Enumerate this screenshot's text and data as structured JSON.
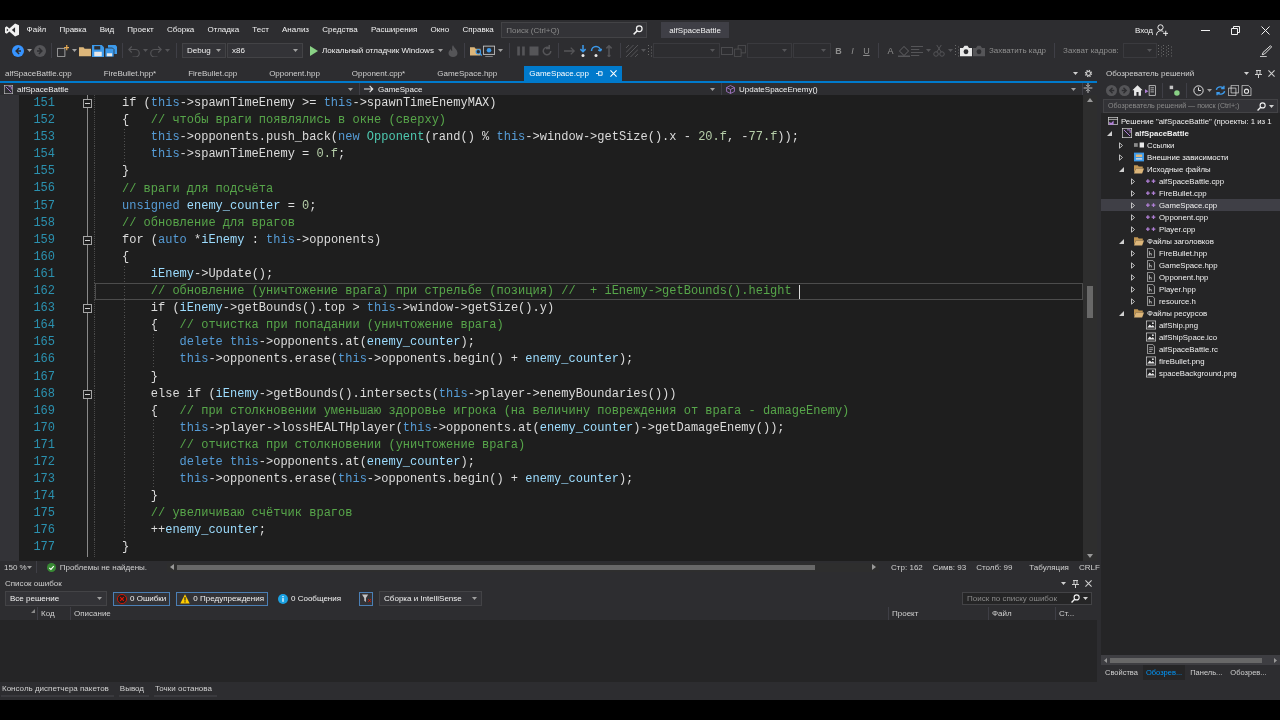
{
  "title_bar": {
    "menu": [
      "Файл",
      "Правка",
      "Вид",
      "Проект",
      "Сборка",
      "Отладка",
      "Тест",
      "Анализ",
      "Средства",
      "Расширения",
      "Окно",
      "Справка"
    ],
    "search": {
      "placeholder": "Поиск (Ctrl+Q)"
    },
    "solution_name": "alfSpaceBattle",
    "sign_in": "Вход"
  },
  "toolbar": {
    "items": [
      {
        "kind": "icon",
        "disabled": false,
        "dropdown": true
      },
      {
        "kind": "icon",
        "disabled": true,
        "dropdown": false
      },
      {
        "kind": "separator"
      },
      {
        "kind": "icon",
        "disabled": false,
        "dropdown": true
      },
      {
        "kind": "icon",
        "disabled": false,
        "dropdown": false
      },
      {
        "kind": "icon",
        "disabled": false,
        "dropdown": false
      },
      {
        "kind": "icon",
        "disabled": false,
        "dropdown": false
      },
      {
        "kind": "separator"
      },
      {
        "kind": "icon",
        "disabled": true,
        "dropdown": true
      },
      {
        "kind": "icon",
        "disabled": true,
        "dropdown": true
      },
      {
        "kind": "separator"
      },
      {
        "kind": "combo",
        "value": "Debug",
        "disabled": false
      },
      {
        "kind": "combo",
        "value": "x86",
        "disabled": false
      },
      {
        "kind": "run",
        "label": "Локальный отладчик Windows"
      },
      {
        "kind": "icon",
        "disabled": true,
        "dropdown": false
      },
      {
        "kind": "separator"
      },
      {
        "kind": "icon",
        "disabled": false,
        "dropdown": false
      },
      {
        "kind": "icon",
        "disabled": false,
        "dropdown": true
      },
      {
        "kind": "separator"
      },
      {
        "kind": "icon",
        "disabled": true,
        "dropdown": false
      },
      {
        "kind": "icon",
        "disabled": true,
        "dropdown": false
      },
      {
        "kind": "icon",
        "disabled": true,
        "dropdown": false
      },
      {
        "kind": "separator"
      },
      {
        "kind": "icon",
        "disabled": true,
        "dropdown": false
      },
      {
        "kind": "icon",
        "disabled": false,
        "dropdown": false
      },
      {
        "kind": "icon",
        "disabled": false,
        "dropdown": false
      },
      {
        "kind": "icon",
        "disabled": true,
        "dropdown": false
      },
      {
        "kind": "separator"
      },
      {
        "kind": "icon",
        "disabled": true,
        "dropdown": true
      },
      {
        "kind": "grip"
      },
      {
        "kind": "combo",
        "disabled": true
      },
      {
        "kind": "icon",
        "disabled": true,
        "dropdown": false
      },
      {
        "kind": "icon",
        "disabled": true,
        "dropdown": false
      },
      {
        "kind": "combo",
        "disabled": true
      },
      {
        "kind": "combo",
        "disabled": true
      },
      {
        "kind": "glyph",
        "text": "B",
        "disabled": true
      },
      {
        "kind": "glyph",
        "text": "I",
        "disabled": true
      },
      {
        "kind": "glyph",
        "text": "U",
        "disabled": true
      },
      {
        "kind": "separator"
      },
      {
        "kind": "glyph",
        "text": "A",
        "disabled": true
      },
      {
        "kind": "icon",
        "disabled": true,
        "dropdown": false
      },
      {
        "kind": "icon",
        "disabled": true,
        "dropdown": true
      },
      {
        "kind": "icon",
        "disabled": true,
        "dropdown": true
      },
      {
        "kind": "grip"
      },
      {
        "kind": "icon",
        "disabled": false,
        "dropdown": false
      },
      {
        "kind": "icon",
        "disabled": true,
        "dropdown": false
      },
      {
        "kind": "label",
        "text": "Захватить кадр",
        "disabled": true
      },
      {
        "kind": "separator"
      },
      {
        "kind": "label",
        "text": "Захват кадров:",
        "disabled": true
      },
      {
        "kind": "combo",
        "disabled": true
      },
      {
        "kind": "grip"
      },
      {
        "kind": "grip"
      },
      {
        "kind": "grip"
      },
      {
        "kind": "icon",
        "disabled": false,
        "dropdown": false
      }
    ]
  },
  "document_tabs": [
    {
      "label": "alfSpaceBattle.cpp",
      "selected": false
    },
    {
      "label": "FireBullet.hpp*",
      "selected": false
    },
    {
      "label": "FireBullet.cpp",
      "selected": false
    },
    {
      "label": "Opponent.hpp",
      "selected": false
    },
    {
      "label": "Opponent.cpp*",
      "selected": false
    },
    {
      "label": "GameSpace.hpp",
      "selected": false
    },
    {
      "label": "GameSpace.cpp",
      "selected": true
    }
  ],
  "navigation_bar": {
    "project": "alfSpaceBattle",
    "scope": "GameSpace",
    "member": "UpdateSpaceEnemy()"
  },
  "editor": {
    "lines": [
      {
        "number": "151",
        "current": false,
        "expanded": true,
        "tokens": [
          {
            "kind": "plain",
            "text": "if ("
          },
          {
            "kind": "keyword",
            "text": "this"
          },
          {
            "kind": "plain",
            "text": "->spawnTimeEnemy >= "
          },
          {
            "kind": "keyword",
            "text": "this"
          },
          {
            "kind": "plain",
            "text": "->spawnTimeEnemyMAX)"
          }
        ]
      },
      {
        "number": "152",
        "current": false,
        "tokens": [
          {
            "kind": "plain",
            "text": "{   "
          },
          {
            "kind": "comment",
            "text": "// чтобы враги появлялись в окне (сверху)"
          }
        ],
        "children": [
          {
            "number": "153",
            "current": false,
            "tokens": [
              {
                "kind": "keyword",
                "text": "this"
              },
              {
                "kind": "plain",
                "text": "->opponents.push_back("
              },
              {
                "kind": "keyword",
                "text": "new "
              },
              {
                "kind": "type",
                "text": "Opponent"
              },
              {
                "kind": "plain",
                "text": "(rand() % "
              },
              {
                "kind": "keyword",
                "text": "this"
              },
              {
                "kind": "plain",
                "text": "->window->getSize().x - "
              },
              {
                "kind": "number",
                "text": "20.f"
              },
              {
                "kind": "plain",
                "text": ", -"
              },
              {
                "kind": "number",
                "text": "77.f"
              },
              {
                "kind": "plain",
                "text": "));"
              }
            ]
          },
          {
            "number": "154",
            "current": false,
            "tokens": [
              {
                "kind": "keyword",
                "text": "this"
              },
              {
                "kind": "plain",
                "text": "->spawnTimeEnemy = "
              },
              {
                "kind": "number",
                "text": "0.f"
              },
              {
                "kind": "plain",
                "text": ";"
              }
            ]
          }
        ]
      },
      {
        "number": "155",
        "current": false,
        "tokens": [
          {
            "kind": "plain",
            "text": "}"
          }
        ]
      },
      {
        "number": "156",
        "current": false,
        "tokens": [
          {
            "kind": "comment",
            "text": "// враги для подсчёта"
          }
        ]
      },
      {
        "number": "157",
        "current": false,
        "tokens": [
          {
            "kind": "keyword",
            "text": "unsigned "
          },
          {
            "kind": "local",
            "text": "enemy_counter"
          },
          {
            "kind": "plain",
            "text": " = "
          },
          {
            "kind": "number",
            "text": "0"
          },
          {
            "kind": "plain",
            "text": ";"
          }
        ]
      },
      {
        "number": "158",
        "current": false,
        "tokens": [
          {
            "kind": "comment",
            "text": "// обновление для врагов"
          }
        ]
      },
      {
        "number": "159",
        "current": false,
        "expanded": true,
        "tokens": [
          {
            "kind": "plain",
            "text": "for ("
          },
          {
            "kind": "keyword",
            "text": "auto"
          },
          {
            "kind": "plain",
            "text": " *"
          },
          {
            "kind": "local",
            "text": "iEnemy"
          },
          {
            "kind": "plain",
            "text": " : "
          },
          {
            "kind": "keyword",
            "text": "this"
          },
          {
            "kind": "plain",
            "text": "->opponents)"
          }
        ]
      },
      {
        "number": "160",
        "current": false,
        "tokens": [
          {
            "kind": "plain",
            "text": "{"
          }
        ],
        "children": [
          {
            "number": "161",
            "current": false,
            "tokens": [
              {
                "kind": "local",
                "text": "iEnemy"
              },
              {
                "kind": "plain",
                "text": "->Update();"
              }
            ]
          },
          {
            "number": "162",
            "current": true,
            "tokens": [
              {
                "kind": "comment",
                "text": "// обновление (уничтожение врага) при стрельбе (позиция) //  + iEnemy->getBounds().height"
              }
            ]
          },
          {
            "number": "163",
            "current": false,
            "expanded": true,
            "tokens": [
              {
                "kind": "plain",
                "text": "if ("
              },
              {
                "kind": "local",
                "text": "iEnemy"
              },
              {
                "kind": "plain",
                "text": "->getBounds().top > "
              },
              {
                "kind": "keyword",
                "text": "this"
              },
              {
                "kind": "plain",
                "text": "->window->getSize().y)"
              }
            ]
          },
          {
            "number": "164",
            "current": false,
            "tokens": [
              {
                "kind": "plain",
                "text": "{   "
              },
              {
                "kind": "comment",
                "text": "// отчистка при попадании (уничтожение врага)"
              }
            ],
            "children": [
              {
                "number": "165",
                "current": false,
                "tokens": [
                  {
                    "kind": "keyword",
                    "text": "delete this"
                  },
                  {
                    "kind": "plain",
                    "text": "->opponents.at("
                  },
                  {
                    "kind": "local",
                    "text": "enemy_counter"
                  },
                  {
                    "kind": "plain",
                    "text": ");"
                  }
                ]
              },
              {
                "number": "166",
                "current": false,
                "tokens": [
                  {
                    "kind": "keyword",
                    "text": "this"
                  },
                  {
                    "kind": "plain",
                    "text": "->opponents.erase("
                  },
                  {
                    "kind": "keyword",
                    "text": "this"
                  },
                  {
                    "kind": "plain",
                    "text": "->opponents.begin() + "
                  },
                  {
                    "kind": "local",
                    "text": "enemy_counter"
                  },
                  {
                    "kind": "plain",
                    "text": ");"
                  }
                ]
              }
            ]
          },
          {
            "number": "167",
            "current": false,
            "tokens": [
              {
                "kind": "plain",
                "text": "}"
              }
            ]
          },
          {
            "number": "168",
            "current": false,
            "expanded": true,
            "tokens": [
              {
                "kind": "plain",
                "text": "else if ("
              },
              {
                "kind": "local",
                "text": "iEnemy"
              },
              {
                "kind": "plain",
                "text": "->getBounds().intersects("
              },
              {
                "kind": "keyword",
                "text": "this"
              },
              {
                "kind": "plain",
                "text": "->player->enemyBoundaries()))"
              }
            ]
          },
          {
            "number": "169",
            "current": false,
            "tokens": [
              {
                "kind": "plain",
                "text": "{   "
              },
              {
                "kind": "comment",
                "text": "// при столкновении уменьшаю здоровье игрока (на величину повреждения от врага - damageEnemy)"
              }
            ],
            "children": [
              {
                "number": "170",
                "current": false,
                "tokens": [
                  {
                    "kind": "keyword",
                    "text": "this"
                  },
                  {
                    "kind": "plain",
                    "text": "->player->lossHEALTHplayer("
                  },
                  {
                    "kind": "keyword",
                    "text": "this"
                  },
                  {
                    "kind": "plain",
                    "text": "->opponents.at("
                  },
                  {
                    "kind": "local",
                    "text": "enemy_counter"
                  },
                  {
                    "kind": "plain",
                    "text": ")->getDamageEnemy());"
                  }
                ]
              },
              {
                "number": "171",
                "current": false,
                "tokens": [
                  {
                    "kind": "comment",
                    "text": "// отчистка при столкновении (уничтожение врага)"
                  }
                ]
              },
              {
                "number": "172",
                "current": false,
                "tokens": [
                  {
                    "kind": "keyword",
                    "text": "delete this"
                  },
                  {
                    "kind": "plain",
                    "text": "->opponents.at("
                  },
                  {
                    "kind": "local",
                    "text": "enemy_counter"
                  },
                  {
                    "kind": "plain",
                    "text": ");"
                  }
                ]
              },
              {
                "number": "173",
                "current": false,
                "tokens": [
                  {
                    "kind": "keyword",
                    "text": "this"
                  },
                  {
                    "kind": "plain",
                    "text": "->opponents.erase("
                  },
                  {
                    "kind": "keyword",
                    "text": "this"
                  },
                  {
                    "kind": "plain",
                    "text": "->opponents.begin() + "
                  },
                  {
                    "kind": "local",
                    "text": "enemy_counter"
                  },
                  {
                    "kind": "plain",
                    "text": ");"
                  }
                ]
              }
            ]
          },
          {
            "number": "174",
            "current": false,
            "tokens": [
              {
                "kind": "plain",
                "text": "}"
              }
            ]
          },
          {
            "number": "175",
            "current": false,
            "tokens": [
              {
                "kind": "comment",
                "text": "// увеличиваю счётчик врагов"
              }
            ]
          },
          {
            "number": "176",
            "current": false,
            "tokens": [
              {
                "kind": "plain",
                "text": "++"
              },
              {
                "kind": "local",
                "text": "enemy_counter"
              },
              {
                "kind": "plain",
                "text": ";"
              }
            ]
          }
        ]
      },
      {
        "number": "177",
        "current": false,
        "tokens": [
          {
            "kind": "plain",
            "text": "}"
          }
        ]
      }
    ]
  },
  "editor_status": {
    "zoom": "150 %",
    "health": "Проблемы не найдены.",
    "line": "Стр: 162",
    "char": "Симв: 93",
    "column": "Столб: 99",
    "indentation": "Табуляция",
    "line_endings": "CRLF"
  },
  "error_list": {
    "title": "Список ошибок",
    "scope": "Все решение",
    "filters": [
      {
        "kind": "error",
        "label": "0 Ошибки",
        "selected": true
      },
      {
        "kind": "warning",
        "label": "0 Предупреждения",
        "selected": true
      },
      {
        "kind": "message",
        "label": "0 Сообщения",
        "selected": false
      }
    ],
    "filter_toggle": {
      "selected": true
    },
    "source": "Сборка и IntelliSense",
    "search": {
      "placeholder": "Поиск по списку ошибок"
    },
    "columns": [
      "Код",
      "Описание",
      "Проект",
      "Файл",
      "Ст..."
    ]
  },
  "bottom_tabs": [
    {
      "label": "Консоль диспетчера пакетов",
      "selected": false
    },
    {
      "label": "Вывод",
      "selected": false
    },
    {
      "label": "Точки останова",
      "selected": false
    }
  ],
  "solution_explorer": {
    "title": "Обозреватель решений",
    "toolbar": {
      "items": [
        {
          "kind": "icon",
          "disabled": true,
          "dropdown": false
        },
        {
          "kind": "icon",
          "disabled": true,
          "dropdown": false
        },
        {
          "kind": "icon",
          "disabled": false,
          "dropdown": false
        },
        {
          "kind": "icon",
          "disabled": false,
          "dropdown": false
        },
        {
          "kind": "separator"
        },
        {
          "kind": "icon",
          "disabled": false,
          "dropdown": false
        },
        {
          "kind": "separator"
        },
        {
          "kind": "icon",
          "disabled": false,
          "dropdown": true
        },
        {
          "kind": "icon",
          "disabled": false,
          "dropdown": false
        },
        {
          "kind": "icon",
          "disabled": false,
          "dropdown": false
        },
        {
          "kind": "icon",
          "disabled": false,
          "dropdown": false
        }
      ]
    },
    "search": {
      "placeholder": "Обозреватель решений — поиск (Ctrl+;)"
    },
    "tree": [
      {
        "label": "Решение \"alfSpaceBattle\" (проекты: 1 из 1",
        "kind": "solution",
        "selected": false,
        "children": [
          {
            "label": "alfSpaceBattle",
            "kind": "project",
            "selected": false,
            "expanded": true,
            "children": [
              {
                "label": "Ссылки",
                "kind": "references",
                "selected": false,
                "expanded": false
              },
              {
                "label": "Внешние зависимости",
                "kind": "dependencies",
                "selected": false,
                "expanded": false
              },
              {
                "label": "Исходные файлы",
                "kind": "folder",
                "selected": false,
                "expanded": true,
                "children": [
                  {
                    "label": "alfSpaceBattle.cpp",
                    "kind": "cpp",
                    "selected": false,
                    "expanded": false
                  },
                  {
                    "label": "FireBullet.cpp",
                    "kind": "cpp",
                    "selected": false,
                    "expanded": false
                  },
                  {
                    "label": "GameSpace.cpp",
                    "kind": "cpp",
                    "selected": true,
                    "expanded": false
                  },
                  {
                    "label": "Opponent.cpp",
                    "kind": "cpp",
                    "selected": false,
                    "expanded": false
                  },
                  {
                    "label": "Player.cpp",
                    "kind": "cpp",
                    "selected": false,
                    "expanded": false
                  }
                ]
              },
              {
                "label": "Файлы заголовков",
                "kind": "folder",
                "selected": false,
                "expanded": true,
                "children": [
                  {
                    "label": "FireBullet.hpp",
                    "kind": "header",
                    "selected": false,
                    "expanded": false
                  },
                  {
                    "label": "GameSpace.hpp",
                    "kind": "header",
                    "selected": false,
                    "expanded": false
                  },
                  {
                    "label": "Opponent.hpp",
                    "kind": "header",
                    "selected": false,
                    "expanded": false
                  },
                  {
                    "label": "Player.hpp",
                    "kind": "header",
                    "selected": false,
                    "expanded": false
                  },
                  {
                    "label": "resource.h",
                    "kind": "header",
                    "selected": false,
                    "expanded": false
                  }
                ]
              },
              {
                "label": "Файлы ресурсов",
                "kind": "folder",
                "selected": false,
                "expanded": true,
                "children": [
                  {
                    "label": "alfShip.png",
                    "kind": "image",
                    "selected": false
                  },
                  {
                    "label": "alfShipSpace.ico",
                    "kind": "image",
                    "selected": false
                  },
                  {
                    "label": "alfSpaceBattle.rc",
                    "kind": "resource",
                    "selected": false
                  },
                  {
                    "label": "fireBullet.png",
                    "kind": "image",
                    "selected": false
                  },
                  {
                    "label": "spaceBackground.png",
                    "kind": "image",
                    "selected": false
                  }
                ]
              }
            ]
          }
        ]
      }
    ],
    "tabs": [
      {
        "label": "Свойства",
        "selected": false
      },
      {
        "label": "Обозрев...",
        "selected": true
      },
      {
        "label": "Панель...",
        "selected": false
      },
      {
        "label": "Обозрев...",
        "selected": false
      }
    ]
  }
}
